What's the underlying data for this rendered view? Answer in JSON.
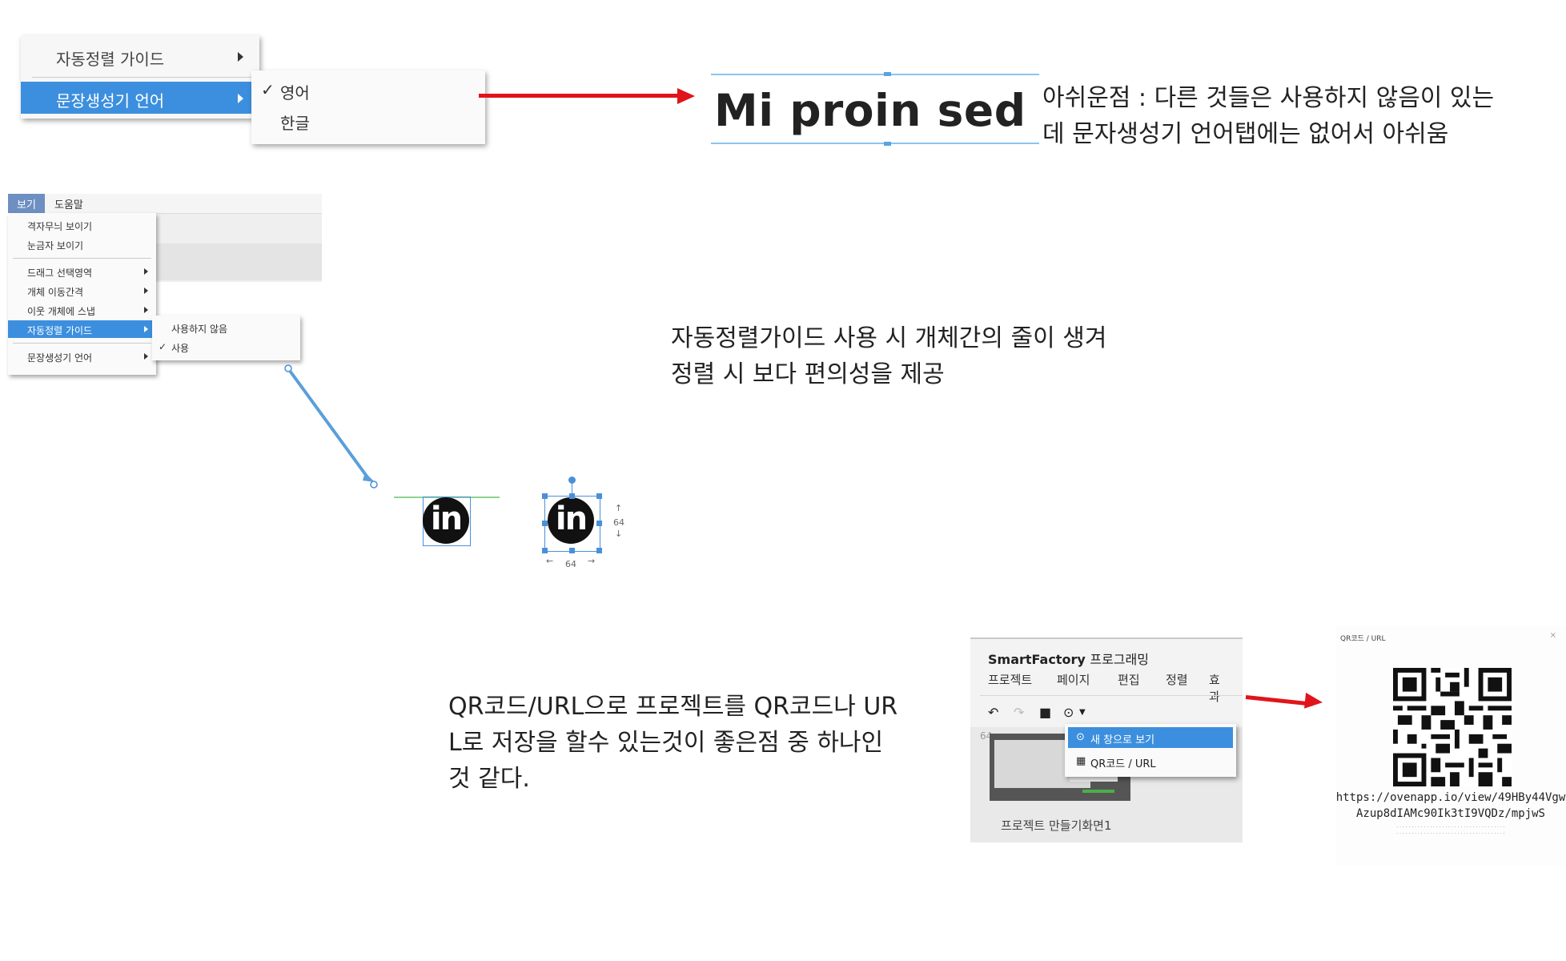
{
  "section1": {
    "menu": {
      "item1": "자동정렬 가이드",
      "item2": "문장생성기 언어"
    },
    "submenu": {
      "check": "✓",
      "opt1": "영어",
      "opt2": "한글"
    },
    "sample_text": "Mi proin sed",
    "note_line1": "아쉬운점 : 다른 것들은 사용하지 않음이 있는",
    "note_line2": "데 문자생성기 언어탭에는 없어서 아쉬움"
  },
  "section2": {
    "menubar": {
      "view": "보기",
      "help": "도움말"
    },
    "menu": {
      "items": [
        "격자무늬 보이기",
        "눈금자 보이기",
        "드래그 선택영역",
        "개체 이동간격",
        "이웃 개체에 스냅",
        "자동정렬 가이드",
        "문장생성기 언어"
      ]
    },
    "submenu": {
      "opt1": "사용하지 않음",
      "check": "✓",
      "opt2": "사용"
    },
    "icon_text": "in",
    "dim_w": "64",
    "dim_h": "64",
    "note_line1": "자동정렬가이드 사용 시 개체간의 줄이 생겨",
    "note_line2": "정렬 시 보다 편의성을 제공"
  },
  "section3": {
    "note_line1": "QR코드/URL으로 프로젝트를 QR코드나 UR",
    "note_line2": "L로 저장을 할수 있는것이 좋은점 중 하나인",
    "note_line3": "것 같다.",
    "app": {
      "title_bold": "SmartFactory",
      "title_rest": "프로그래밍",
      "tabs": [
        "프로젝트",
        "페이지",
        "편집",
        "정렬",
        "효과"
      ],
      "page_number": "64",
      "caption": "프로젝트 만들기화면1"
    },
    "dropdown": {
      "item1": "새 창으로 보기",
      "item2": "QR코드 / URL"
    },
    "qr_panel": {
      "header": "QR코드 / URL",
      "close": "×",
      "url_line1": "https://ovenapp.io/view/49HBy44Vgw",
      "url_line2": "Azup8dIAMc90Ik3tI9VQDz/mpjwS"
    }
  },
  "colors": {
    "accent_blue": "#3c8fde",
    "arrow_red": "#e0141a",
    "guide_green": "#8fd48f"
  }
}
